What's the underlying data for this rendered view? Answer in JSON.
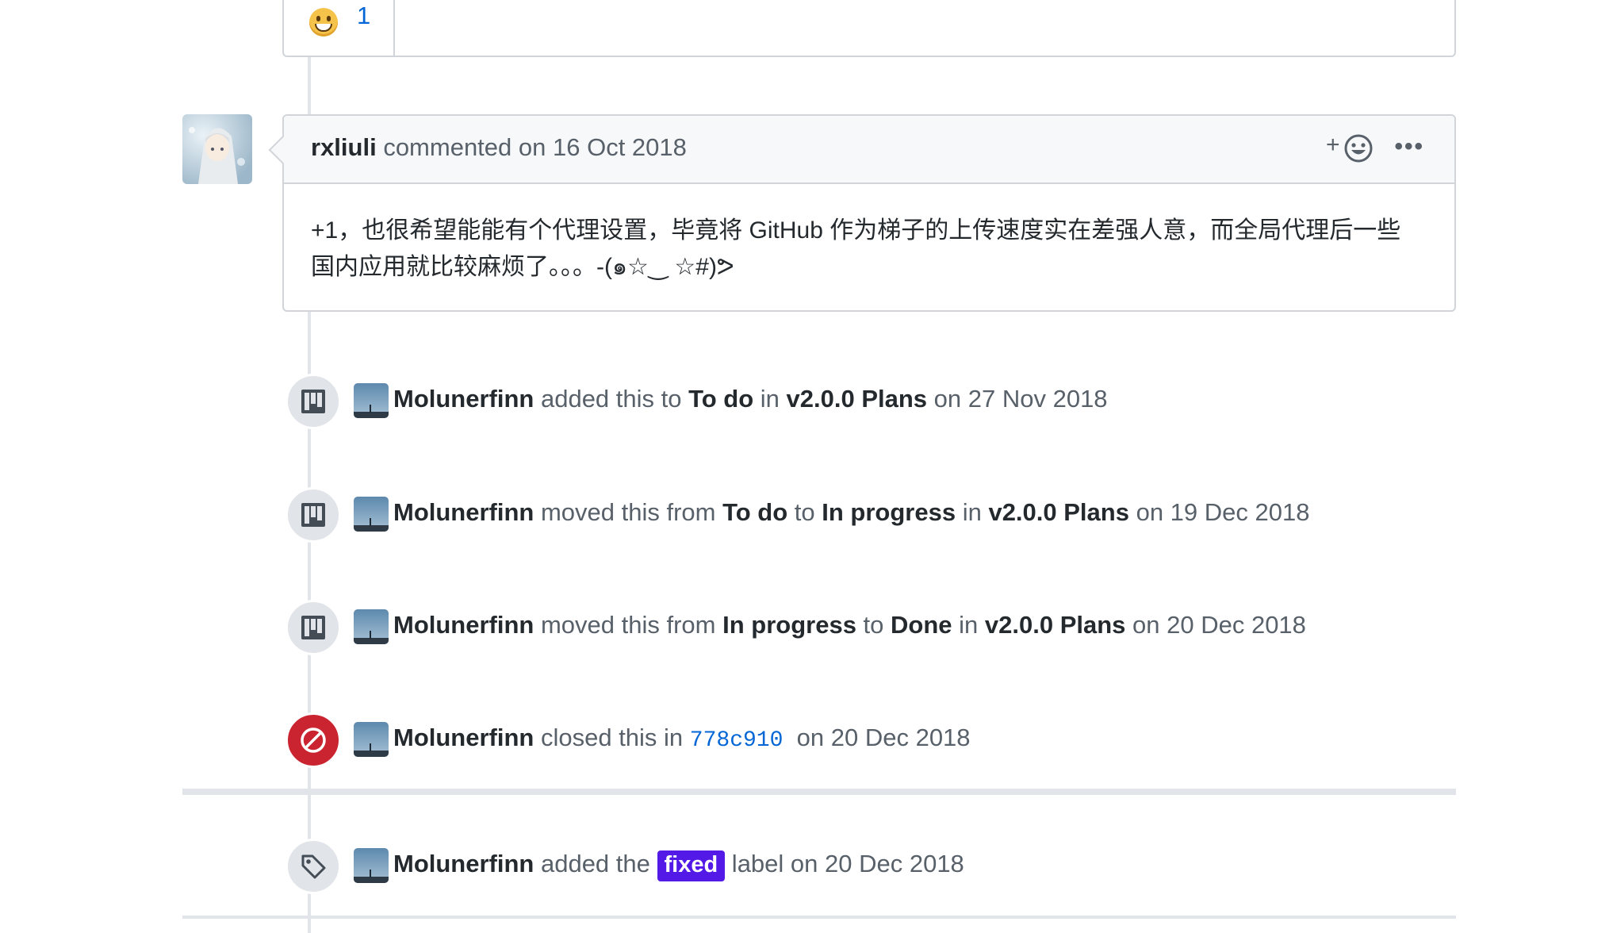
{
  "reaction": {
    "emoji": "smile-emoji",
    "count": "1"
  },
  "comment": {
    "author": "rxliuli",
    "action": " commented ",
    "date": "on 16 Oct 2018",
    "body_line1": "+1，也很希望能能有个代理设置，毕竟将 GitHub 作为梯子的上传速度实在差强人意，而全局代理后一些",
    "body_line2": "国内应用就比较麻烦了。。。-(๑☆‿ ☆#)ᕗ",
    "add_reaction_label": "+",
    "more_label": "•••"
  },
  "events": [
    {
      "type": "project",
      "icon": "project-icon",
      "actor": "Molunerfinn",
      "parts": [
        " added this to ",
        "To do",
        " in ",
        "v2.0.0 Plans",
        " on 27 Nov 2018"
      ]
    },
    {
      "type": "project",
      "icon": "project-icon",
      "actor": "Molunerfinn",
      "parts": [
        " moved this from ",
        "To do",
        " to ",
        "In progress",
        " in ",
        "v2.0.0 Plans",
        " on 19 Dec 2018"
      ]
    },
    {
      "type": "project",
      "icon": "project-icon",
      "actor": "Molunerfinn",
      "parts": [
        " moved this from ",
        "In progress",
        " to ",
        "Done",
        " in ",
        "v2.0.0 Plans",
        " on 20 Dec 2018"
      ]
    },
    {
      "type": "closed",
      "icon": "circle-slash-icon",
      "actor": "Molunerfinn",
      "text_before": " closed this in ",
      "commit": "778c910",
      "text_after": "  on 20 Dec 2018"
    },
    {
      "type": "label",
      "icon": "tag-icon",
      "actor": "Molunerfinn",
      "text_before": " added the ",
      "label": "fixed",
      "text_after": " label on 20 Dec 2018"
    }
  ],
  "colors": {
    "closed_red": "#cb2431",
    "label_fixed": "#5319e7",
    "link_blue": "#0366d6"
  }
}
